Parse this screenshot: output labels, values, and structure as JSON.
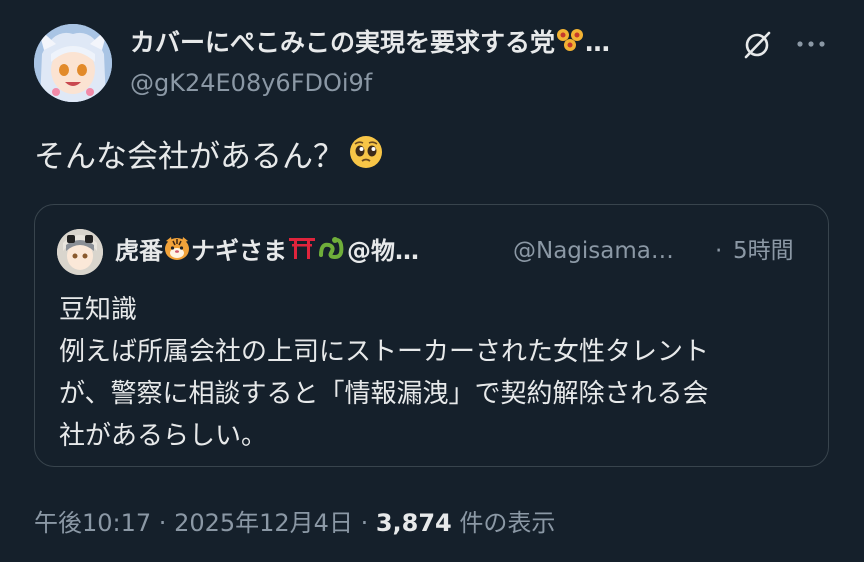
{
  "author": {
    "display_name": "カバーにぺこみこの実現を要求する党",
    "name_suffix": "…",
    "handle": "@gK24E08y6FDOi9f"
  },
  "tweet": {
    "text": "そんな会社があるん？"
  },
  "quote": {
    "name_part1": "虎番",
    "name_part2": "ナギさま",
    "name_part3": "@物…",
    "handle": "@Nagisama…",
    "dot": "·",
    "time": "5時間",
    "lines": [
      "豆知識",
      "例えば所属会社の上司にストーカーされた女性タレント",
      "が、警察に相談すると「情報漏洩」で契約解除される会",
      "社があるらしい。"
    ]
  },
  "meta": {
    "time": "午後10:17",
    "sep1": " · ",
    "date": "2025年12月4日",
    "sep2": " · ",
    "views_count": "3,874",
    "views_label": " 件の表示"
  },
  "icons": {
    "grok": "grok-icon",
    "more": "more-dots-icon",
    "emoji_pleading": "pleading-face-emoji",
    "emoji_tiger": "tiger-face-emoji",
    "emoji_torii": "torii-emoji",
    "emoji_snake": "snake-emoji",
    "emoji_flowers": "flowers-emoji"
  },
  "colors": {
    "background": "#15202b",
    "text_primary": "#e7e9ea",
    "text_secondary": "#8b98a5",
    "border": "#38444d"
  }
}
